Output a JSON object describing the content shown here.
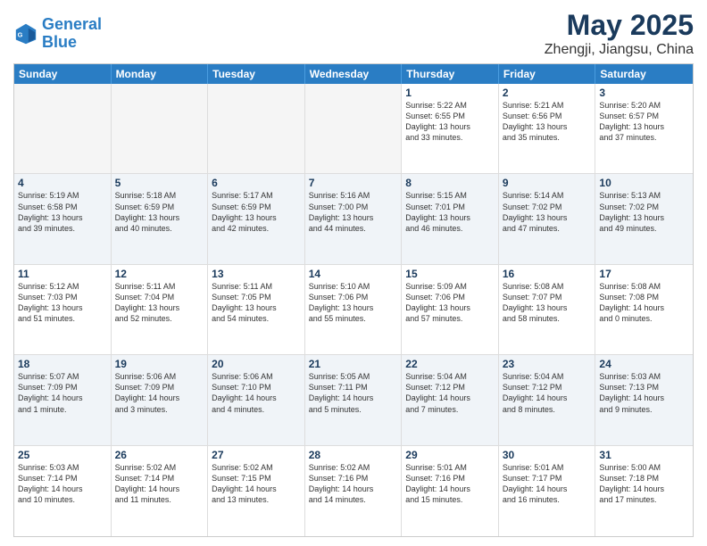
{
  "logo": {
    "line1": "General",
    "line2": "Blue"
  },
  "title": "May 2025",
  "subtitle": "Zhengji, Jiangsu, China",
  "days_of_week": [
    "Sunday",
    "Monday",
    "Tuesday",
    "Wednesday",
    "Thursday",
    "Friday",
    "Saturday"
  ],
  "weeks": [
    [
      {
        "day": "",
        "empty": true
      },
      {
        "day": "",
        "empty": true
      },
      {
        "day": "",
        "empty": true
      },
      {
        "day": "",
        "empty": true
      },
      {
        "day": "1",
        "info": "Sunrise: 5:22 AM\nSunset: 6:55 PM\nDaylight: 13 hours\nand 33 minutes."
      },
      {
        "day": "2",
        "info": "Sunrise: 5:21 AM\nSunset: 6:56 PM\nDaylight: 13 hours\nand 35 minutes."
      },
      {
        "day": "3",
        "info": "Sunrise: 5:20 AM\nSunset: 6:57 PM\nDaylight: 13 hours\nand 37 minutes."
      }
    ],
    [
      {
        "day": "4",
        "info": "Sunrise: 5:19 AM\nSunset: 6:58 PM\nDaylight: 13 hours\nand 39 minutes."
      },
      {
        "day": "5",
        "info": "Sunrise: 5:18 AM\nSunset: 6:59 PM\nDaylight: 13 hours\nand 40 minutes."
      },
      {
        "day": "6",
        "info": "Sunrise: 5:17 AM\nSunset: 6:59 PM\nDaylight: 13 hours\nand 42 minutes."
      },
      {
        "day": "7",
        "info": "Sunrise: 5:16 AM\nSunset: 7:00 PM\nDaylight: 13 hours\nand 44 minutes."
      },
      {
        "day": "8",
        "info": "Sunrise: 5:15 AM\nSunset: 7:01 PM\nDaylight: 13 hours\nand 46 minutes."
      },
      {
        "day": "9",
        "info": "Sunrise: 5:14 AM\nSunset: 7:02 PM\nDaylight: 13 hours\nand 47 minutes."
      },
      {
        "day": "10",
        "info": "Sunrise: 5:13 AM\nSunset: 7:02 PM\nDaylight: 13 hours\nand 49 minutes."
      }
    ],
    [
      {
        "day": "11",
        "info": "Sunrise: 5:12 AM\nSunset: 7:03 PM\nDaylight: 13 hours\nand 51 minutes."
      },
      {
        "day": "12",
        "info": "Sunrise: 5:11 AM\nSunset: 7:04 PM\nDaylight: 13 hours\nand 52 minutes."
      },
      {
        "day": "13",
        "info": "Sunrise: 5:11 AM\nSunset: 7:05 PM\nDaylight: 13 hours\nand 54 minutes."
      },
      {
        "day": "14",
        "info": "Sunrise: 5:10 AM\nSunset: 7:06 PM\nDaylight: 13 hours\nand 55 minutes."
      },
      {
        "day": "15",
        "info": "Sunrise: 5:09 AM\nSunset: 7:06 PM\nDaylight: 13 hours\nand 57 minutes."
      },
      {
        "day": "16",
        "info": "Sunrise: 5:08 AM\nSunset: 7:07 PM\nDaylight: 13 hours\nand 58 minutes."
      },
      {
        "day": "17",
        "info": "Sunrise: 5:08 AM\nSunset: 7:08 PM\nDaylight: 14 hours\nand 0 minutes."
      }
    ],
    [
      {
        "day": "18",
        "info": "Sunrise: 5:07 AM\nSunset: 7:09 PM\nDaylight: 14 hours\nand 1 minute."
      },
      {
        "day": "19",
        "info": "Sunrise: 5:06 AM\nSunset: 7:09 PM\nDaylight: 14 hours\nand 3 minutes."
      },
      {
        "day": "20",
        "info": "Sunrise: 5:06 AM\nSunset: 7:10 PM\nDaylight: 14 hours\nand 4 minutes."
      },
      {
        "day": "21",
        "info": "Sunrise: 5:05 AM\nSunset: 7:11 PM\nDaylight: 14 hours\nand 5 minutes."
      },
      {
        "day": "22",
        "info": "Sunrise: 5:04 AM\nSunset: 7:12 PM\nDaylight: 14 hours\nand 7 minutes."
      },
      {
        "day": "23",
        "info": "Sunrise: 5:04 AM\nSunset: 7:12 PM\nDaylight: 14 hours\nand 8 minutes."
      },
      {
        "day": "24",
        "info": "Sunrise: 5:03 AM\nSunset: 7:13 PM\nDaylight: 14 hours\nand 9 minutes."
      }
    ],
    [
      {
        "day": "25",
        "info": "Sunrise: 5:03 AM\nSunset: 7:14 PM\nDaylight: 14 hours\nand 10 minutes."
      },
      {
        "day": "26",
        "info": "Sunrise: 5:02 AM\nSunset: 7:14 PM\nDaylight: 14 hours\nand 11 minutes."
      },
      {
        "day": "27",
        "info": "Sunrise: 5:02 AM\nSunset: 7:15 PM\nDaylight: 14 hours\nand 13 minutes."
      },
      {
        "day": "28",
        "info": "Sunrise: 5:02 AM\nSunset: 7:16 PM\nDaylight: 14 hours\nand 14 minutes."
      },
      {
        "day": "29",
        "info": "Sunrise: 5:01 AM\nSunset: 7:16 PM\nDaylight: 14 hours\nand 15 minutes."
      },
      {
        "day": "30",
        "info": "Sunrise: 5:01 AM\nSunset: 7:17 PM\nDaylight: 14 hours\nand 16 minutes."
      },
      {
        "day": "31",
        "info": "Sunrise: 5:00 AM\nSunset: 7:18 PM\nDaylight: 14 hours\nand 17 minutes."
      }
    ]
  ]
}
